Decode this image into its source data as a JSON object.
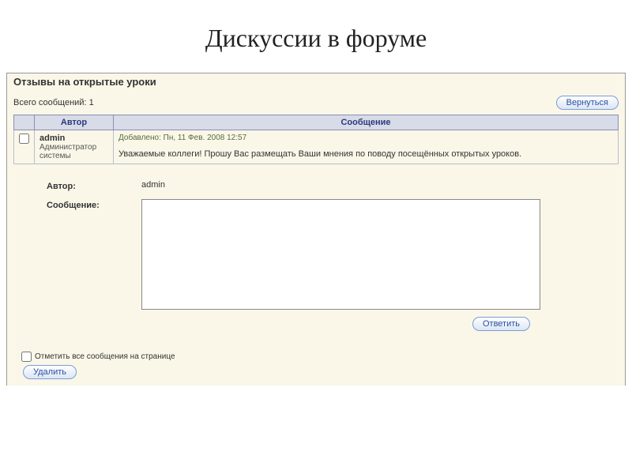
{
  "slide_title": "Дискуссии в форуме",
  "forum": {
    "title": "Отзывы на открытые уроки",
    "count_label": "Всего сообщений: 1",
    "back_button": "Вернуться",
    "columns": {
      "author": "Автор",
      "message": "Сообщение"
    },
    "post": {
      "author_name": "admin",
      "author_role": "Администратор системы",
      "meta": "Добавлено: Пн, 11 Фев. 2008 12:57",
      "body": "Уважаемые коллеги! Прошу Вас размещать Ваши мнения по поводу посещённых открытых уроков."
    },
    "reply": {
      "author_label": "Автор:",
      "author_value": "admin",
      "message_label": "Сообщение:",
      "message_value": "",
      "submit": "Ответить"
    },
    "footer": {
      "mark_all": "Отметить все сообщения на странице",
      "delete": "Удалить"
    }
  }
}
